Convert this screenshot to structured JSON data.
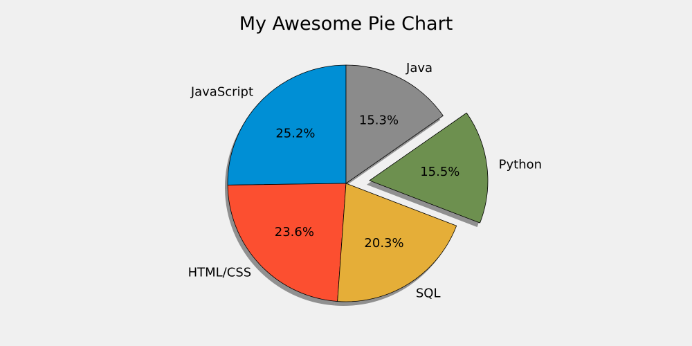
{
  "chart_data": {
    "type": "pie",
    "title": "My Awesome Pie Chart",
    "slices": [
      {
        "label": "JavaScript",
        "value": 25.2,
        "pct_label": "25.2%",
        "color": "#008fd5",
        "explode": 0
      },
      {
        "label": "HTML/CSS",
        "value": 23.6,
        "pct_label": "23.6%",
        "color": "#fc4f30",
        "explode": 0
      },
      {
        "label": "SQL",
        "value": 20.3,
        "pct_label": "20.3%",
        "color": "#e5ae38",
        "explode": 0
      },
      {
        "label": "Python",
        "value": 15.5,
        "pct_label": "15.5%",
        "color": "#6d904f",
        "explode": 0.2
      },
      {
        "label": "Java",
        "value": 15.3,
        "pct_label": "15.3%",
        "color": "#8b8b8b",
        "explode": 0
      }
    ],
    "start_angle_deg": 90,
    "direction": "counterclockwise",
    "shadow": true,
    "edge_color": "#000000",
    "legend": "none",
    "grid": false
  }
}
